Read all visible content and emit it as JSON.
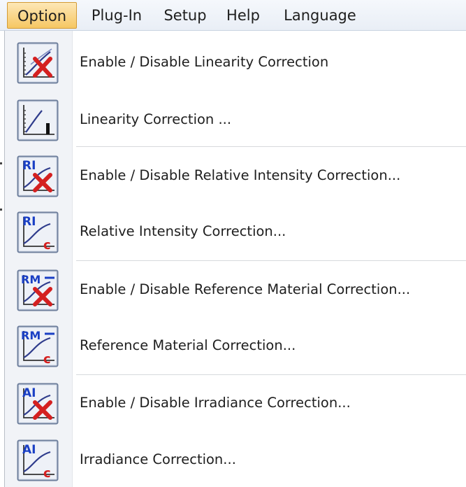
{
  "menubar": {
    "items": [
      {
        "label": "Option",
        "active": true
      },
      {
        "label": "Plug-In",
        "active": false
      },
      {
        "label": "Setup",
        "active": false
      },
      {
        "label": "Help",
        "active": false
      },
      {
        "label": "Language",
        "active": false
      }
    ]
  },
  "option_menu": {
    "items": [
      {
        "label": "Enable / Disable Linearity Correction",
        "icon": "linearity-toggle-icon",
        "icon_text": ""
      },
      {
        "label": "Linearity Correction ...",
        "icon": "linearity-icon",
        "icon_text": ""
      },
      {
        "label": "Enable / Disable Relative Intensity Correction...",
        "icon": "relative-intensity-toggle-icon",
        "icon_text": "RI"
      },
      {
        "label": "Relative Intensity Correction...",
        "icon": "relative-intensity-icon",
        "icon_text": "RI"
      },
      {
        "label": "Enable / Disable Reference Material Correction...",
        "icon": "reference-material-toggle-icon",
        "icon_text": "RM"
      },
      {
        "label": "Reference Material Correction...",
        "icon": "reference-material-icon",
        "icon_text": "RM"
      },
      {
        "label": "Enable / Disable Irradiance Correction...",
        "icon": "irradiance-toggle-icon",
        "icon_text": "AI"
      },
      {
        "label": "Irradiance Correction...",
        "icon": "irradiance-icon",
        "icon_text": "AI"
      }
    ]
  },
  "colors": {
    "active_menu_bg": "#f6c763",
    "icon_letters": "#1a3fc4",
    "icon_cross": "#d42020",
    "icon_curve": "#2f3c8c"
  }
}
